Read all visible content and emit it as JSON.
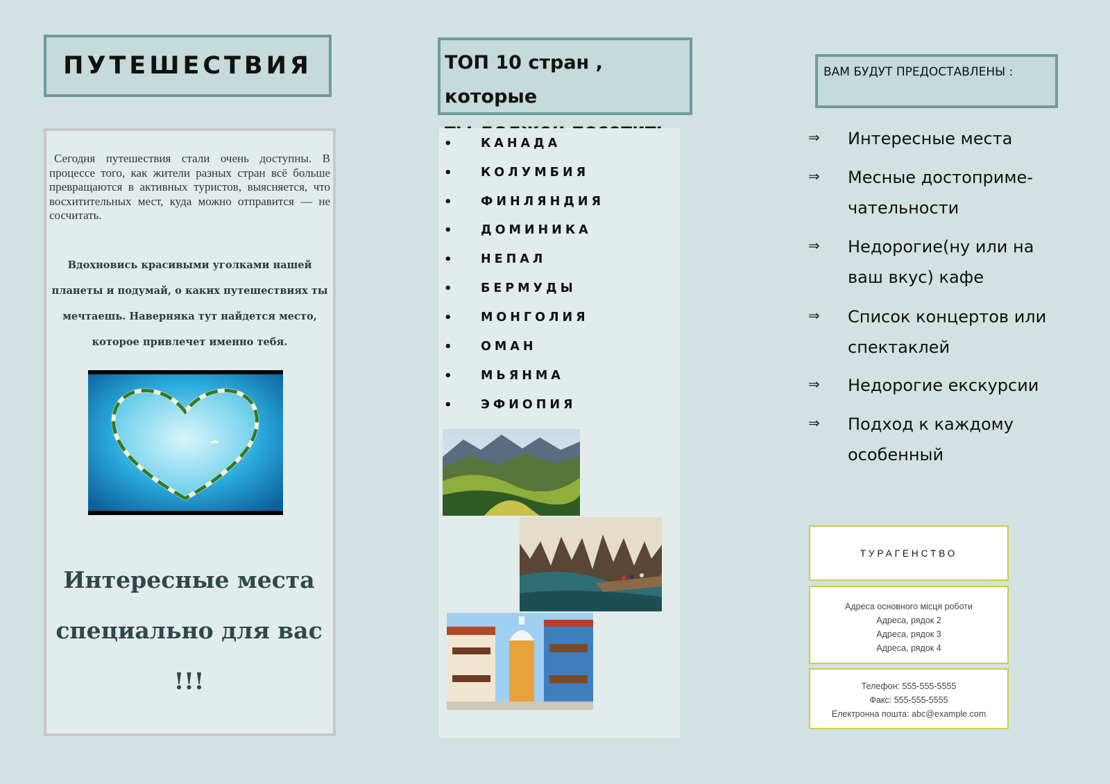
{
  "left": {
    "title": "ПУТЕШЕСТВИЯ",
    "intro": "Сегодня путешествия стали очень доступны. В процессе того, как жители разных стран всё больше превращаются в активных туристов, выясняется, что восхитительных мест, куда можно отправится — не сосчитать.",
    "inspire": "Вдохновись красивыми уголками нашей планеты и подумай, о каких путешествиях ты мечтаешь. Наверняка тут найдется место, которое привлечет именно тебя.",
    "slogan": "Интересные места специально для вас !!!"
  },
  "middle": {
    "heading_line1": "ТОП 10 стран , которые",
    "heading_line2": "ты должен посетить",
    "bullet": "•",
    "countries": [
      "КАНАДА",
      "КОЛУМБИЯ",
      "ФИНЛЯНДИЯ",
      "ДОМИНИКА",
      "НЕПАЛ",
      "БЕРМУДЫ",
      "МОНГОЛИЯ",
      "ОМАН",
      "МЬЯНМА",
      "ЭФИОПИЯ"
    ]
  },
  "right": {
    "heading": "ВАМ БУДУТ ПРЕДОСТАВЛЕНЫ :",
    "arrow": "⇒",
    "benefits": [
      "Интересные места",
      "Месные достоприме-чательности",
      "Недорогие(ну или на ваш вкус) кафе",
      "Список концертов  или спектаклей",
      "Недорогие екскурсии",
      "Подход к каждому особенный"
    ],
    "agency": {
      "title": "ТУРАГЕНСТВО",
      "address_lines": [
        "Адреса основного місця роботи",
        "Адреса, рядок 2",
        "Адреса, рядок 3",
        "Адреса, рядок 4"
      ],
      "phone": "Телефон: 555-555-5555",
      "fax": "Факс: 555-555-5555",
      "email": "Електронна пошта: abc@example.com"
    }
  },
  "colors": {
    "page_bg": "#d2e2e3",
    "header_box_bg": "#c4dadb",
    "header_box_border": "#6e9a9a",
    "panel_bg": "#e2ecec",
    "agency_border": "#c8cf45"
  }
}
